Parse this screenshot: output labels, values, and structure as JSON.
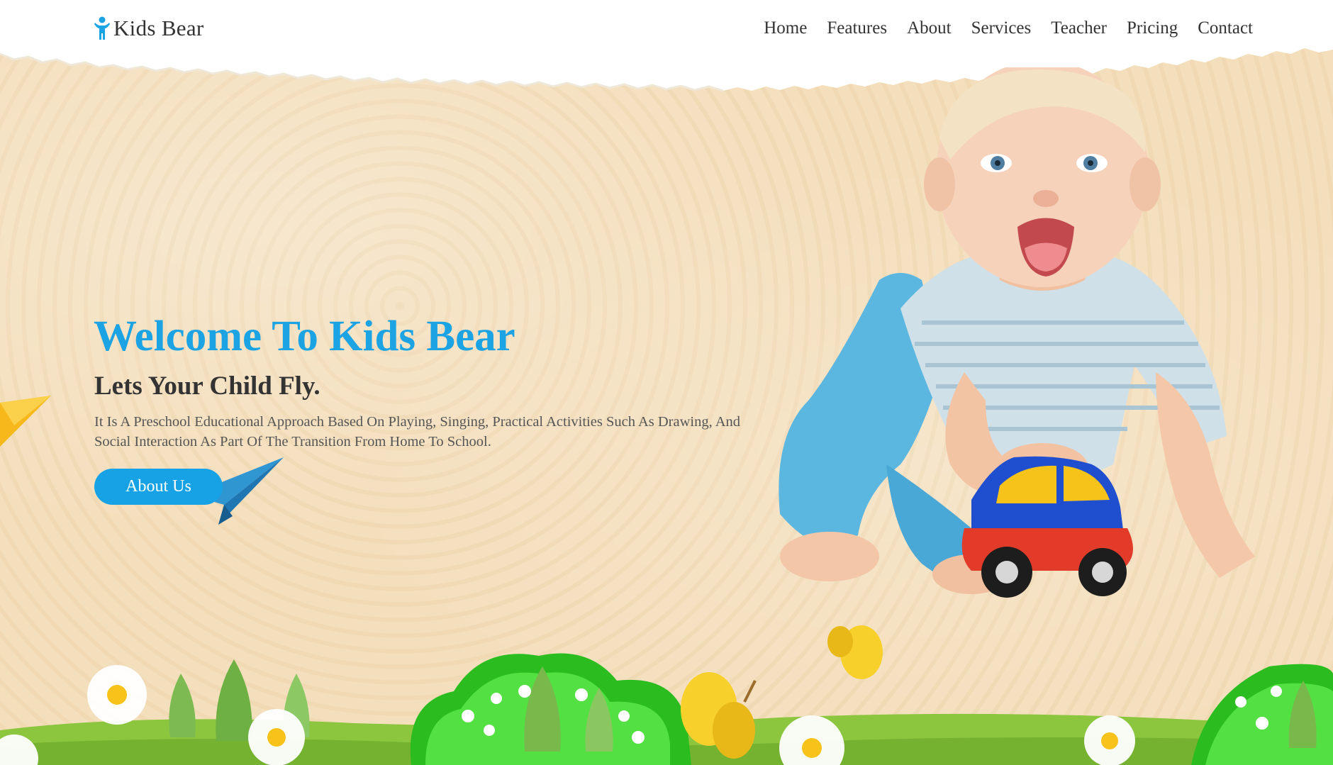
{
  "brand": {
    "name": "Kids Bear",
    "icon": "child-figure-icon",
    "icon_color": "#1ba3e4"
  },
  "nav": {
    "items": [
      {
        "label": "Home"
      },
      {
        "label": "Features"
      },
      {
        "label": "About"
      },
      {
        "label": "Services"
      },
      {
        "label": "Teacher"
      },
      {
        "label": "Pricing"
      },
      {
        "label": "Contact"
      }
    ]
  },
  "hero": {
    "title": "Welcome To Kids Bear",
    "subtitle": "Lets Your Child Fly.",
    "description": "It Is A Preschool Educational Approach Based On Playing, Singing, Practical Activities Such As Drawing, And Social Interaction As Part Of The Transition From Home To School.",
    "button_label": "About Us"
  },
  "colors": {
    "accent": "#1ba3e4",
    "background": "#f4dfbd",
    "text_dark": "#333333",
    "grass": "#8cc63f"
  }
}
